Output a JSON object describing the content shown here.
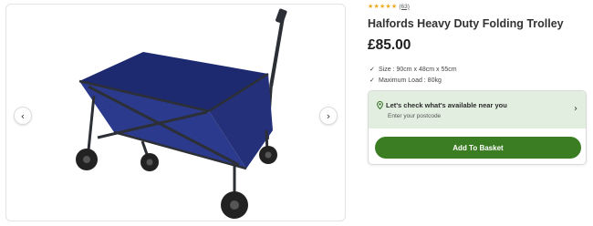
{
  "product": {
    "stars": "★★★★★",
    "rating_count": "(63)",
    "title": "Halfords Heavy Duty Folding Trolley",
    "price": "£85.00",
    "specs": [
      {
        "check": "✓",
        "text": "Size : 90cm x 48cm x 55cm"
      },
      {
        "check": "✓",
        "text": "Maximum Load : 80kg"
      }
    ]
  },
  "gallery": {
    "prev_icon": "‹",
    "next_icon": "›"
  },
  "stock": {
    "title": "Let's check what's available near you",
    "subtitle": "Enter your postcode",
    "chevron": "›"
  },
  "cta": {
    "add_to_basket": "Add To Basket"
  },
  "colors": {
    "accent_green": "#3b7d23",
    "stock_bg": "#e2efe0",
    "star": "#f0a81e",
    "trolley_fabric": "#2b3a8c",
    "trolley_frame": "#2c2f36"
  }
}
